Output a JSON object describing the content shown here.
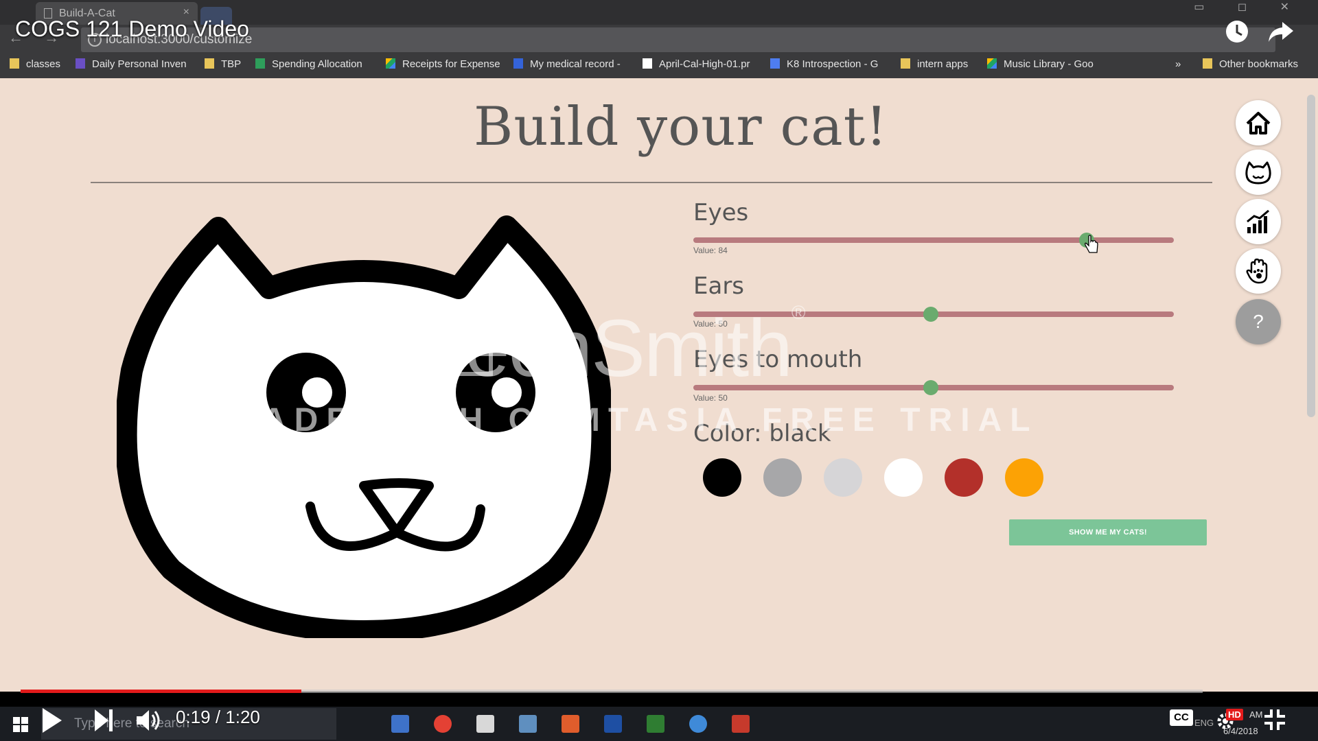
{
  "browser": {
    "tab_title": "Build-A-Cat",
    "tab_close": "×",
    "url": "localhost:3000/customize",
    "info_icon": "i",
    "bookmarks": [
      {
        "label": "classes",
        "icon": "folder"
      },
      {
        "label": "Daily Personal Inven",
        "icon": "list"
      },
      {
        "label": "TBP",
        "icon": "folder"
      },
      {
        "label": "Spending Allocation",
        "icon": "sheet"
      },
      {
        "label": "Receipts for Expense",
        "icon": "drive"
      },
      {
        "label": "My medical record -",
        "icon": "mimg"
      },
      {
        "label": "April-Cal-High-01.pr",
        "icon": "docw"
      },
      {
        "label": "K8 Introspection - G",
        "icon": "docb"
      },
      {
        "label": "intern apps",
        "icon": "folder"
      },
      {
        "label": "Music Library - Goo",
        "icon": "drive"
      }
    ],
    "more": "»",
    "other_bookmarks": "Other bookmarks"
  },
  "page": {
    "title": "Build your cat!",
    "sliders": [
      {
        "label": "Eyes",
        "value_text": "Value: 84",
        "value": 84
      },
      {
        "label": "Ears",
        "value_text": "Value: 50",
        "value": 50
      },
      {
        "label": "Eyes to mouth",
        "value_text": "Value: 50",
        "value": 50
      }
    ],
    "color_label": "Color: black",
    "colors": [
      "#000000",
      "#a7a7a9",
      "#d6d5d7",
      "#ffffff",
      "#b3302a",
      "#fca205"
    ],
    "show_button": "SHOW ME MY CATS!",
    "nav": [
      "home-icon",
      "cat-face-icon",
      "chart-icon",
      "paw-hand-icon"
    ],
    "help": "?"
  },
  "watermark": {
    "brand": "TechSmith",
    "reg": "®",
    "line2": "MADE WITH CAMTASIA FREE TRIAL"
  },
  "video": {
    "title": "COGS 121 Demo Video",
    "time": "0:19 / 1:20",
    "progress": 0.2375,
    "cc": "CC",
    "hd": "HD"
  },
  "taskbar": {
    "search_placeholder": "Type here to search",
    "date": "6/4/2018",
    "ampm": "AM",
    "lang": "ENG"
  }
}
